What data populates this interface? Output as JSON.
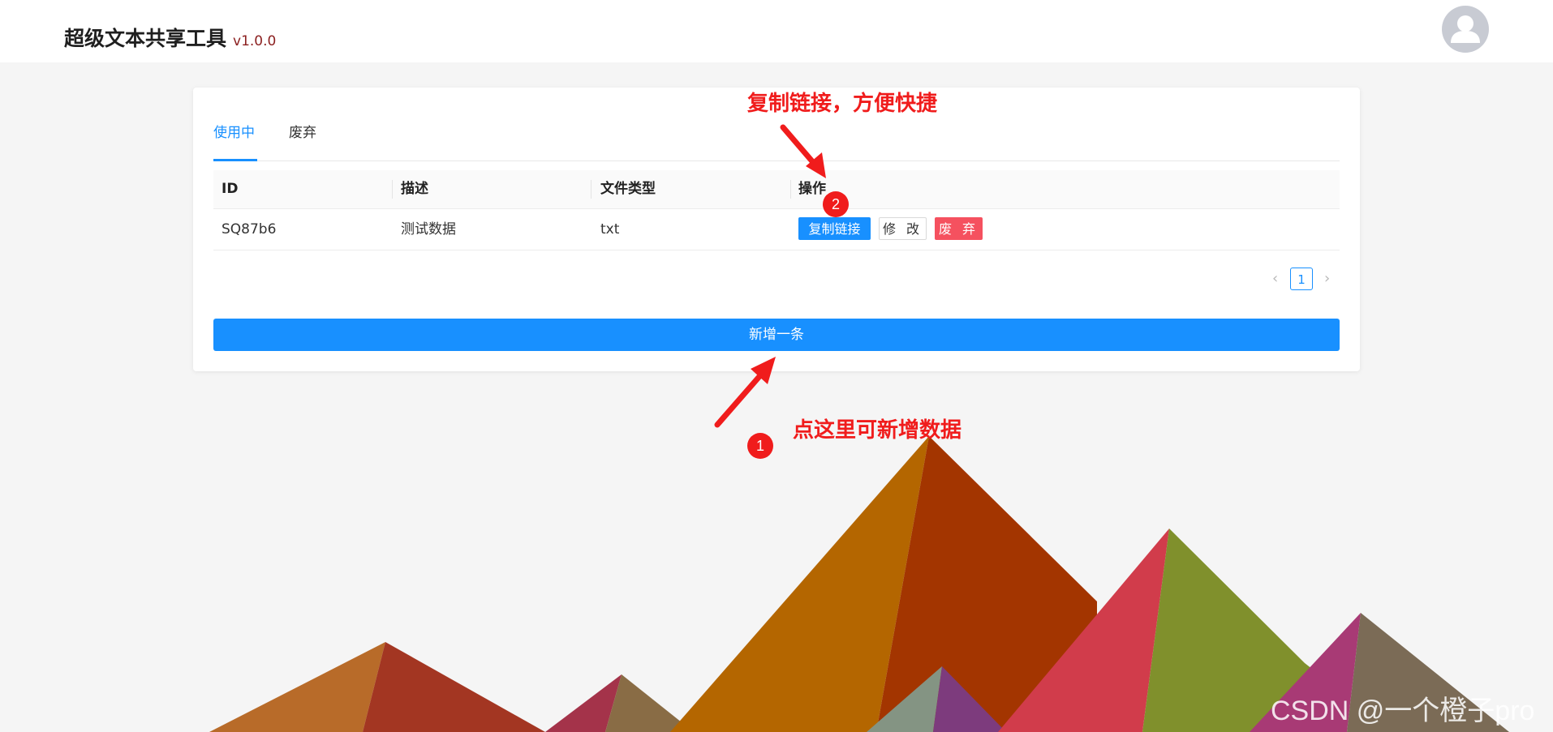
{
  "header": {
    "app_title": "超级文本共享工具",
    "version": "v1.0.0",
    "avatar_icon": "user-avatar-icon"
  },
  "tabs": [
    {
      "label": "使用中",
      "active": true
    },
    {
      "label": "废弃",
      "active": false
    }
  ],
  "table": {
    "columns": [
      "ID",
      "描述",
      "文件类型",
      "操作"
    ],
    "rows": [
      {
        "id": "SQ87b6",
        "description": "测试数据",
        "file_type": "txt",
        "actions": {
          "copy": "复制链接",
          "edit": "修 改",
          "abandon": "废 弃"
        }
      }
    ]
  },
  "pagination": {
    "current": "1",
    "prev_icon": "chevron-left-icon",
    "next_icon": "chevron-right-icon"
  },
  "add_button": "新增一条",
  "annotations": [
    {
      "text": "点这里可新增数据",
      "badge": "1"
    },
    {
      "text": "复制链接，方便快捷",
      "badge": "2"
    }
  ],
  "watermark": "CSDN @一个橙子pro",
  "colors": {
    "primary": "#1890ff",
    "danger": "#f5515f",
    "annotation": "#f01c1c"
  }
}
